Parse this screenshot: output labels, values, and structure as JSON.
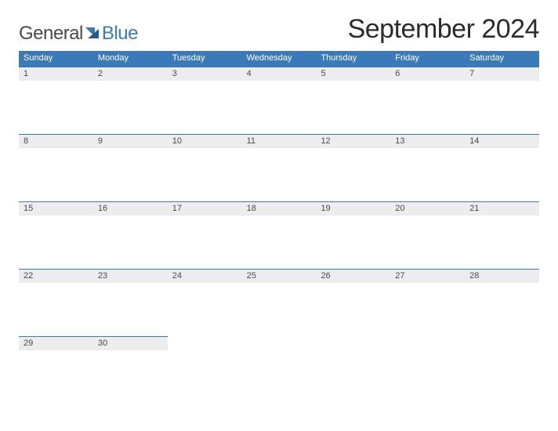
{
  "logo": {
    "text_general": "General",
    "text_blue": "Blue"
  },
  "title": "September 2024",
  "colors": {
    "accent": "#3b7ab8",
    "header_bg": "#3b7ab8",
    "daynum_bg": "#ebedef"
  },
  "day_headers": [
    "Sunday",
    "Monday",
    "Tuesday",
    "Wednesday",
    "Thursday",
    "Friday",
    "Saturday"
  ],
  "weeks": [
    [
      1,
      2,
      3,
      4,
      5,
      6,
      7
    ],
    [
      8,
      9,
      10,
      11,
      12,
      13,
      14
    ],
    [
      15,
      16,
      17,
      18,
      19,
      20,
      21
    ],
    [
      22,
      23,
      24,
      25,
      26,
      27,
      28
    ],
    [
      29,
      30,
      null,
      null,
      null,
      null,
      null
    ]
  ]
}
